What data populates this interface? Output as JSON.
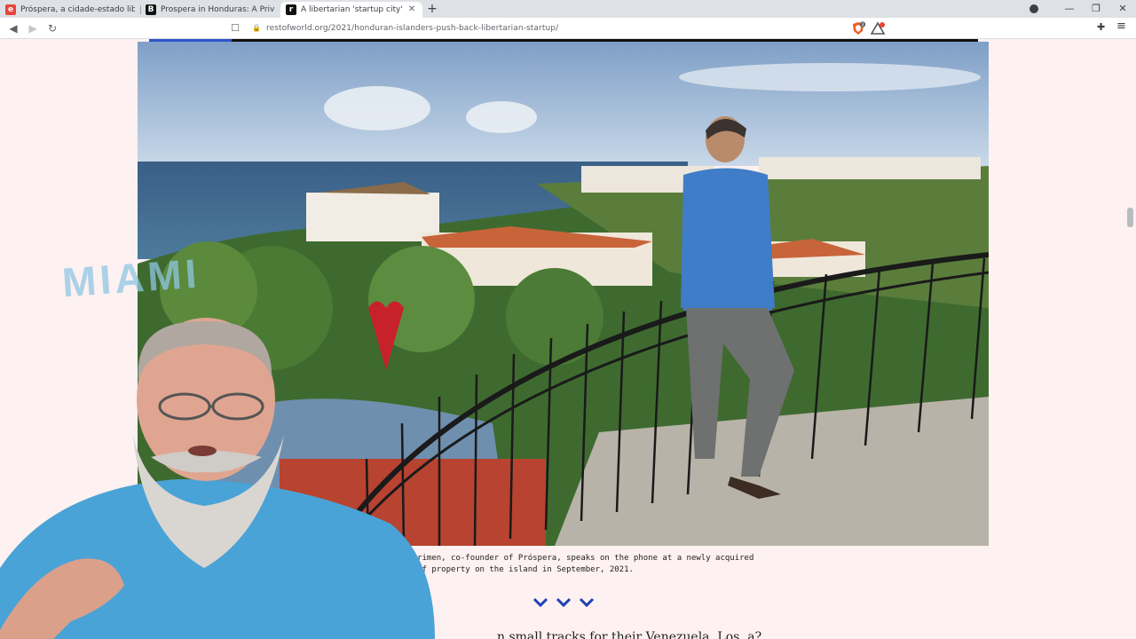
{
  "browser": {
    "tabs": [
      {
        "title": "Próspera, a cidade-estado liberal em",
        "favicon_letter": "e",
        "favicon_color": "#e8443a",
        "active": false
      },
      {
        "title": "Prospera in Honduras: A Private Tech",
        "favicon_letter": "B",
        "favicon_color": "#111111",
        "active": false
      },
      {
        "title": "A libertarian 'startup city' in Hond",
        "favicon_letter": "r",
        "favicon_color": "#111111",
        "active": true
      }
    ],
    "new_tab_label": "+",
    "url": "restofworld.org/2021/honduran-islanders-push-back-libertarian-startup/",
    "brave_shield_count": "3"
  },
  "article": {
    "reading_progress": 0.1,
    "photo_alt": "Man in blue shirt on phone at balcony railing overlooking resort houses and sea",
    "caption_line1": "ick Brimen, co-founder of Próspera, speaks on the phone at a newly acquired",
    "caption_line2": "tion of property on the island in September, 2021.",
    "next_heading": "n small tracks for their Venezuela, Los, a?",
    "accent_color": "#1f3fb4"
  },
  "webcam": {
    "shirt_text": "MIAMI"
  }
}
